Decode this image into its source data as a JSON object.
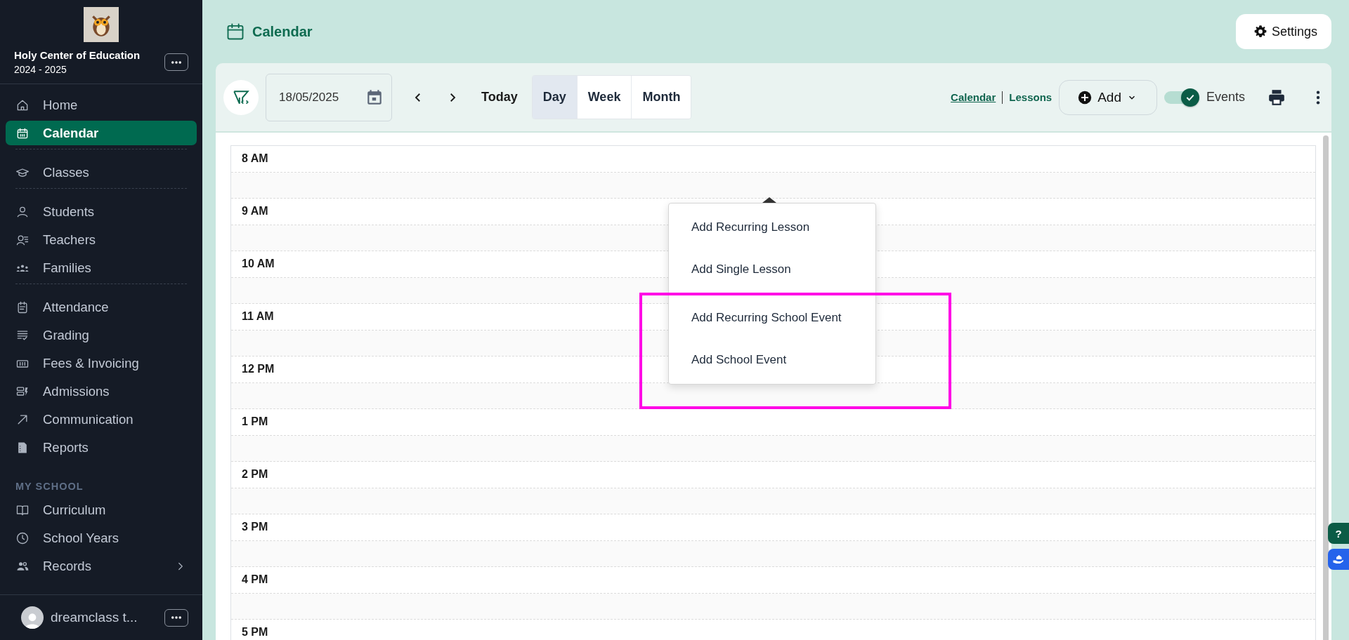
{
  "sidebar": {
    "school": {
      "name": "Holy Center of Education",
      "years": "2024 - 2025"
    },
    "groups": [
      {
        "items": [
          {
            "label": "Home",
            "selected": false
          },
          {
            "label": "Calendar",
            "selected": true
          }
        ]
      },
      {
        "items": [
          {
            "label": "Classes",
            "selected": false
          }
        ]
      },
      {
        "items": [
          {
            "label": "Students",
            "selected": false
          },
          {
            "label": "Teachers",
            "selected": false
          },
          {
            "label": "Families",
            "selected": false
          }
        ]
      },
      {
        "items": [
          {
            "label": "Attendance",
            "selected": false
          },
          {
            "label": "Grading",
            "selected": false
          },
          {
            "label": "Fees & Invoicing",
            "selected": false
          },
          {
            "label": "Admissions",
            "selected": false
          },
          {
            "label": "Communication",
            "selected": false
          },
          {
            "label": "Reports",
            "selected": false
          }
        ]
      },
      {
        "heading": "MY SCHOOL",
        "items": [
          {
            "label": "Curriculum",
            "selected": false
          },
          {
            "label": "School Years",
            "selected": false
          },
          {
            "label": "Records",
            "selected": false,
            "expanded": false
          }
        ]
      }
    ],
    "user": {
      "name": "dreamclass t..."
    }
  },
  "header": {
    "title": "Calendar",
    "settings_button": "Settings"
  },
  "toolbar": {
    "date": "18/05/2025",
    "today": "Today",
    "views": [
      {
        "label": "Day",
        "selected": true
      },
      {
        "label": "Week",
        "selected": false
      },
      {
        "label": "Month",
        "selected": false
      }
    ],
    "modes": [
      {
        "label": "Calendar",
        "selected": true
      },
      {
        "label": "Lessons",
        "selected": false
      }
    ],
    "add_button": "Add",
    "events_toggle": {
      "label": "Events",
      "on": true
    }
  },
  "calendar": {
    "hours": [
      "8 AM",
      "9 AM",
      "10 AM",
      "11 AM",
      "12 PM",
      "1 PM",
      "2 PM",
      "3 PM",
      "4 PM",
      "5 PM"
    ]
  },
  "add_menu": {
    "sections": [
      {
        "items": [
          "Add Recurring Lesson",
          "Add Single Lesson"
        ]
      },
      {
        "items": [
          "Add Recurring School Event",
          "Add School Event"
        ]
      }
    ]
  },
  "annotations": [
    {
      "kind": "frame"
    }
  ],
  "help_button": "?"
}
